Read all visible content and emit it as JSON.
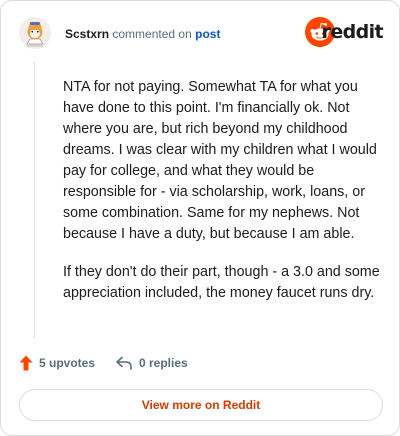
{
  "comment": {
    "author": "Scstxrn",
    "action_text": "commented on",
    "post_link_label": "post",
    "paragraphs": [
      "NTA for not paying. Somewhat TA for what you have done to this point. I'm financially ok. Not where you are, but rich beyond my childhood dreams. I was clear with my children what I would pay for college, and what they would be responsible for - via scholarship, work, loans, or some combination. Same for my nephews. Not because I have a duty, but because I am able.",
      "If they don't do their part, though - a 3.0 and some appreciation included, the money faucet runs dry."
    ]
  },
  "brand": {
    "wordmark": "reddit",
    "logo_icon": "reddit-snoo-icon",
    "accent_color": "#ff4500"
  },
  "stats": {
    "upvotes_label": "5 upvotes",
    "upvote_icon": "upvote-arrow-icon",
    "replies_label": "0 replies",
    "reply_icon": "reply-arrow-icon"
  },
  "cta": {
    "view_more_label": "View more on Reddit",
    "color": "#d93a00"
  }
}
